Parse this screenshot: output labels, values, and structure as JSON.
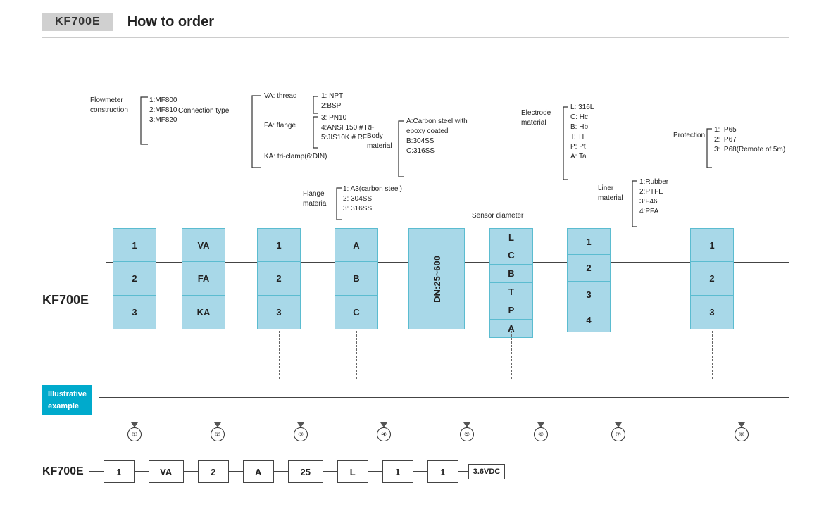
{
  "header": {
    "model": "KF700E",
    "title": "How to order"
  },
  "annotations": {
    "flowmeter_construction": {
      "label": "Flowmeter\nconstruction",
      "options": [
        "1:MF800",
        "2:MF810",
        "3:MF820"
      ]
    },
    "connection_type": {
      "label": "Connection type",
      "options": {
        "va": "VA: thread",
        "va_sub": [
          "1: NPT",
          "2:BSP"
        ],
        "fa": "FA: flange",
        "fa_sub": [
          "3: PN10",
          "4:ANSI 150 # RF",
          "5:JIS10K # RF"
        ],
        "ka": "KA: tri-clamp(6:DIN)"
      }
    },
    "flange_material": {
      "label": "Flange\nmaterial",
      "options": [
        "1: A3(carbon steel)",
        "2: 304SS",
        "3: 316SS"
      ]
    },
    "body_material": {
      "label": "Body\nmaterial",
      "options": [
        "A:Carbon steel with\nepoxy coated",
        "B:304SS",
        "C:316SS"
      ]
    },
    "sensor_diameter": {
      "label": "Sensor diameter"
    },
    "electrode_material": {
      "label": "Electrode\nmaterial",
      "options": [
        "L: 316L",
        "C: Hc",
        "B: Hb",
        "T: TI",
        "P: Pt",
        "A: Ta"
      ]
    },
    "liner_material": {
      "label": "Liner\nmaterial",
      "options": [
        "1:Rubber",
        "2:PTFE",
        "3:F46",
        "4:PFA"
      ]
    },
    "protection": {
      "label": "Protection",
      "options": [
        "1: IP65",
        "2: IP67",
        "3: IP68(Remote of 5m)"
      ]
    }
  },
  "box_columns": [
    {
      "id": "col1",
      "cells": [
        "1",
        "2",
        "3"
      ]
    },
    {
      "id": "col2",
      "cells": [
        "VA",
        "FA",
        "KA"
      ]
    },
    {
      "id": "col3",
      "cells": [
        "1",
        "2",
        "3"
      ]
    },
    {
      "id": "col4",
      "cells": [
        "A",
        "B",
        "C"
      ]
    },
    {
      "id": "col5_tall",
      "cells": [
        "DN:25~600"
      ]
    },
    {
      "id": "col6",
      "cells": [
        "L",
        "C",
        "B",
        "T",
        "P",
        "A"
      ]
    },
    {
      "id": "col7",
      "cells": [
        "1",
        "2",
        "3",
        "4"
      ]
    },
    {
      "id": "col8",
      "cells": [
        "1",
        "2",
        "3"
      ]
    }
  ],
  "main_label": "KF700E",
  "illustrative": {
    "label": "Illustrative\nexample",
    "circles": [
      "①",
      "②",
      "③",
      "④",
      "⑤",
      "⑥",
      "⑦",
      "⑧"
    ]
  },
  "bottom_example": {
    "model": "KF700E",
    "boxes": [
      "1",
      "VA",
      "2",
      "A",
      "25",
      "L",
      "1",
      "1"
    ],
    "suffix": "3.6VDC"
  }
}
